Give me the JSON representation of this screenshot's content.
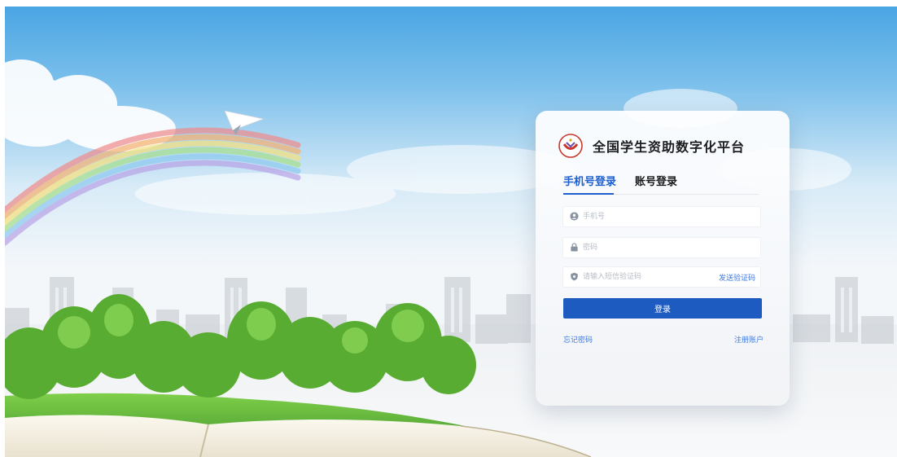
{
  "brand": {
    "title": "全国学生资助数字化平台"
  },
  "tabs": [
    {
      "label": "手机号登录",
      "active": true
    },
    {
      "label": "账号登录",
      "active": false
    }
  ],
  "form": {
    "phone_placeholder": "手机号",
    "password_placeholder": "密码",
    "code_placeholder": "请输入短信验证码",
    "send_code_label": "发送验证码",
    "submit_label": "登录"
  },
  "links": {
    "forgot": "忘记密码",
    "register": "注册账户"
  },
  "colors": {
    "accent": "#1f5fd0",
    "button": "#1d5bc0",
    "link": "#3f7ae0",
    "sky": "#5ab0e8",
    "grass": "#5aa83a"
  },
  "icons": [
    "paper-plane-icon",
    "rainbow-icon",
    "logo-icon",
    "user-icon",
    "lock-icon",
    "shield-icon"
  ]
}
